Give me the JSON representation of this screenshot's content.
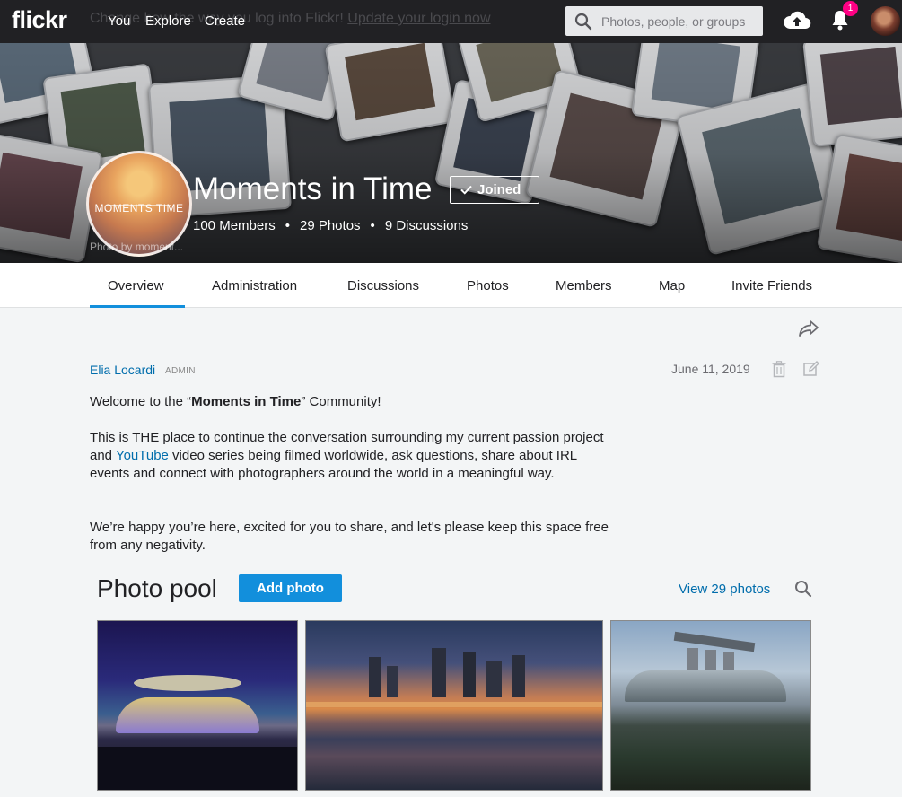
{
  "nav": {
    "logo": "flickr",
    "ghost_banner_start": "Change",
    "ghost_banner_mid": " how  ",
    "ghost_banner_tail": "the way you log into Flickr!",
    "ghost_banner_link": "Update your login now",
    "links": [
      "You",
      "Explore",
      "Create"
    ],
    "search_placeholder": "Photos, people, or groups",
    "notification_count": "1"
  },
  "group": {
    "title": "Moments in Time",
    "icon_text": "MOMENTS TIME",
    "joined_label": "Joined",
    "members": "100 Members",
    "photos": "29 Photos",
    "discussions": "9 Discussions",
    "dot": "•",
    "photo_credit": "Photo by moment..."
  },
  "tabs": [
    "Overview",
    "Administration",
    "Discussions",
    "Photos",
    "Members",
    "Map",
    "Invite Friends"
  ],
  "post": {
    "author": "Elia Locardi",
    "role": "ADMIN",
    "date": "June 11, 2019",
    "p1_before": "Welcome to the “",
    "p1_bold": "Moments in Time",
    "p1_after": "” Community!",
    "p2_before": "This is THE place to continue the conversation surrounding my current passion project and ",
    "p2_link": "YouTube",
    "p2_after": " video series being filmed worldwide, ask questions, share about IRL events and connect with photographers around the world in a meaningful way.",
    "p3": "We’re happy you’re here, excited for you to share, and let's please keep this space free from any negativity."
  },
  "pool": {
    "title": "Photo pool",
    "add_label": "Add photo",
    "view_label": "View 29 photos"
  },
  "colors": {
    "accent": "#128fdc",
    "link": "#006dac",
    "nav_bg": "#212124",
    "badge": "#ff0084"
  }
}
